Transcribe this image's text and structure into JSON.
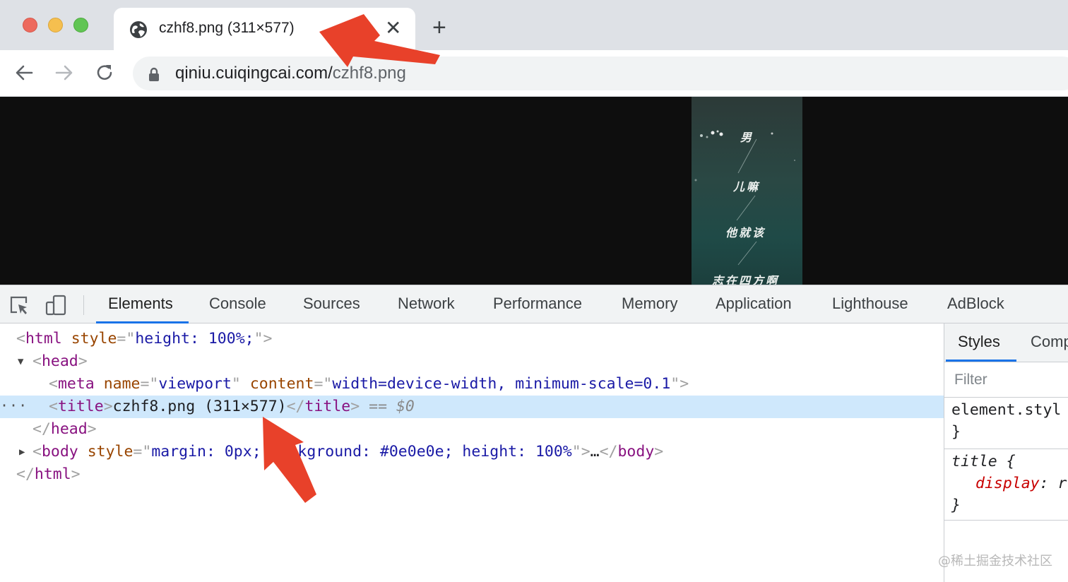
{
  "window": {
    "traffic_lights": [
      "close",
      "minimize",
      "zoom"
    ]
  },
  "tab": {
    "title": "czhf8.png (311×577)",
    "close_glyph": "✕",
    "new_tab_glyph": "+"
  },
  "toolbar": {
    "back_icon": "back-arrow-icon",
    "forward_icon": "forward-arrow-icon",
    "reload_icon": "reload-icon",
    "url_host": "qiniu.cuiqingcai.com/",
    "url_path": "czhf8.png"
  },
  "page": {
    "background": "#0e0e0e",
    "image_text": [
      "男",
      "儿嘛",
      "他就该",
      "志在四方啊"
    ]
  },
  "devtools": {
    "tabs": [
      "Elements",
      "Console",
      "Sources",
      "Network",
      "Performance",
      "Memory",
      "Application",
      "Lighthouse",
      "AdBlock"
    ],
    "active_tab": "Elements",
    "dom": {
      "html_open": {
        "tag": "html",
        "attr": "style",
        "value": "height: 100%;"
      },
      "head_open": "head",
      "meta": {
        "tag": "meta",
        "attr1": "name",
        "val1": "viewport",
        "attr2": "content",
        "val2": "width=device-width, minimum-scale=0.1"
      },
      "title": {
        "tag": "title",
        "text": "czhf8.png (311×577)",
        "marker": "== $0"
      },
      "head_close": "head",
      "body": {
        "tag": "body",
        "attr": "style",
        "value": "margin: 0px; background: #0e0e0e; height: 100%",
        "ellipsis": "…"
      },
      "html_close": "html",
      "selected_dots": "···"
    },
    "styles_pane": {
      "tabs": [
        "Styles",
        "Comp"
      ],
      "filter_placeholder": "Filter",
      "element_style": "element.styl",
      "close_brace": "}",
      "rule_selector": "title {",
      "rule_property": "display",
      "rule_value_fragment": ": r"
    }
  },
  "watermark": "@稀土掘金技术社区",
  "colors": {
    "accent": "#1a73e8",
    "annotation_arrow": "#e8412a",
    "selected_row": "#cfe8fc"
  }
}
